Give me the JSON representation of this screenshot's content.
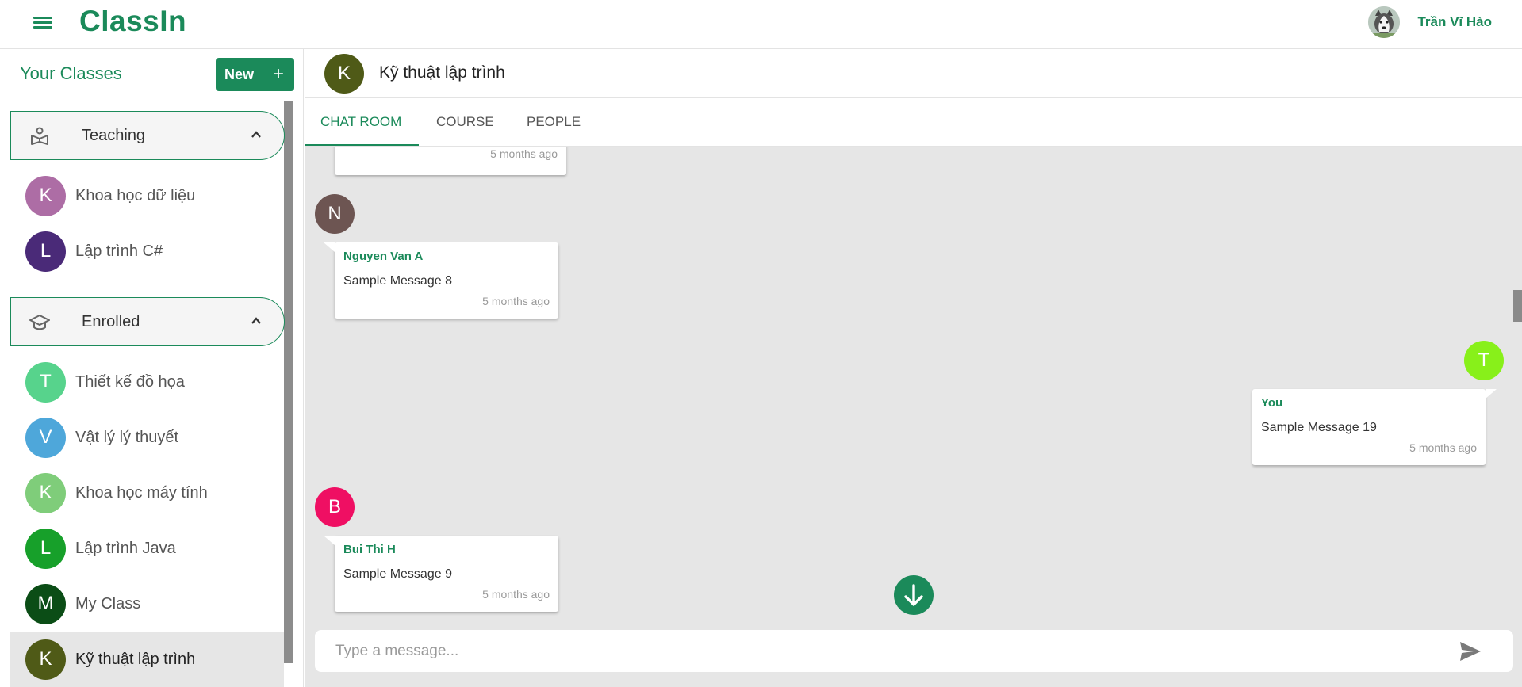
{
  "app": {
    "brand": "ClassIn"
  },
  "user": {
    "name": "Trần Vĩ Hào",
    "avatar_icon": "husky-dog-avatar"
  },
  "sidebar": {
    "title": "Your Classes",
    "new_button": {
      "label": "New",
      "icon": "plus-icon"
    },
    "sections": [
      {
        "label": "Teaching",
        "icon": "teacher-icon",
        "expanded": true,
        "items": [
          {
            "initial": "K",
            "name": "Khoa học dữ liệu",
            "color": "#ad6da5"
          },
          {
            "initial": "L",
            "name": "Lập trình C#",
            "color": "#4a2a78"
          }
        ]
      },
      {
        "label": "Enrolled",
        "icon": "graduation-cap-icon",
        "expanded": true,
        "items": [
          {
            "initial": "T",
            "name": "Thiết kế đồ họa",
            "color": "#57d38c"
          },
          {
            "initial": "V",
            "name": "Vật lý lý thuyết",
            "color": "#4ea7da"
          },
          {
            "initial": "K",
            "name": "Khoa học máy tính",
            "color": "#7fcd7a"
          },
          {
            "initial": "L",
            "name": "Lập trình Java",
            "color": "#17a02a"
          },
          {
            "initial": "M",
            "name": "My Class",
            "color": "#0b4d16"
          },
          {
            "initial": "K",
            "name": "Kỹ thuật lập trình",
            "color": "#4f5a17",
            "active": true
          }
        ]
      }
    ]
  },
  "main": {
    "class_initial": "K",
    "class_title": "Kỹ thuật lập trình",
    "tabs": [
      {
        "label": "CHAT ROOM",
        "active": true
      },
      {
        "label": "COURSE"
      },
      {
        "label": "PEOPLE"
      }
    ]
  },
  "chat": {
    "messages": [
      {
        "sender": "",
        "text": "",
        "time": "5 months ago",
        "partial": true
      },
      {
        "initial": "N",
        "sender": "Nguyen Van A",
        "text": "Sample Message 8",
        "time": "5 months ago",
        "avatar_color": "#6d5552",
        "side": "left"
      },
      {
        "initial": "T",
        "sender": "You",
        "text": "Sample Message 19",
        "time": "5 months ago",
        "avatar_color": "#88f01a",
        "side": "right"
      },
      {
        "initial": "B",
        "sender": "Bui Thi H",
        "text": "Sample Message 9",
        "time": "5 months ago",
        "avatar_color": "#ef0f63",
        "side": "left"
      }
    ],
    "input_placeholder": "Type a message...",
    "send_icon": "send-icon",
    "scroll_down_icon": "arrow-down-icon"
  },
  "colors": {
    "accent": "#1b8a5a",
    "chat_bg": "#e6e6e6"
  }
}
